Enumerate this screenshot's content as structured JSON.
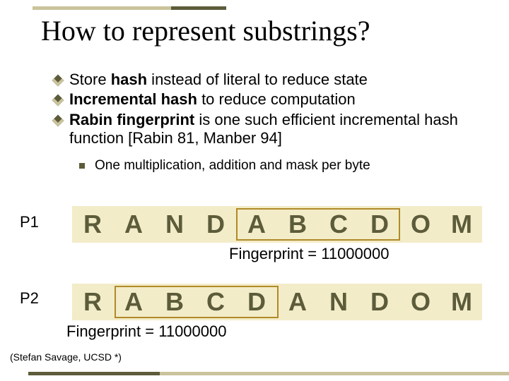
{
  "title": "How to represent substrings?",
  "bullets": [
    {
      "pre": "Store ",
      "bold": "hash",
      "post": " instead of literal to reduce state"
    },
    {
      "bold": "Incremental hash",
      "post": " to reduce computation"
    },
    {
      "bold": "Rabin fingerprint",
      "post": " is one such efficient incremental hash function [Rabin 81, Manber 94]"
    }
  ],
  "sub_bullet": "One multiplication, addition and mask per byte",
  "rows": [
    {
      "label": "P1",
      "chars": [
        "R",
        "A",
        "N",
        "D",
        "A",
        "B",
        "C",
        "D",
        "O",
        "M"
      ],
      "fingerprint": "Fingerprint = 11000000"
    },
    {
      "label": "P2",
      "chars": [
        "R",
        "A",
        "B",
        "C",
        "D",
        "A",
        "N",
        "D",
        "O",
        "M"
      ],
      "fingerprint": "Fingerprint = 11000000"
    }
  ],
  "footer": "(Stefan Savage, UCSD *)"
}
